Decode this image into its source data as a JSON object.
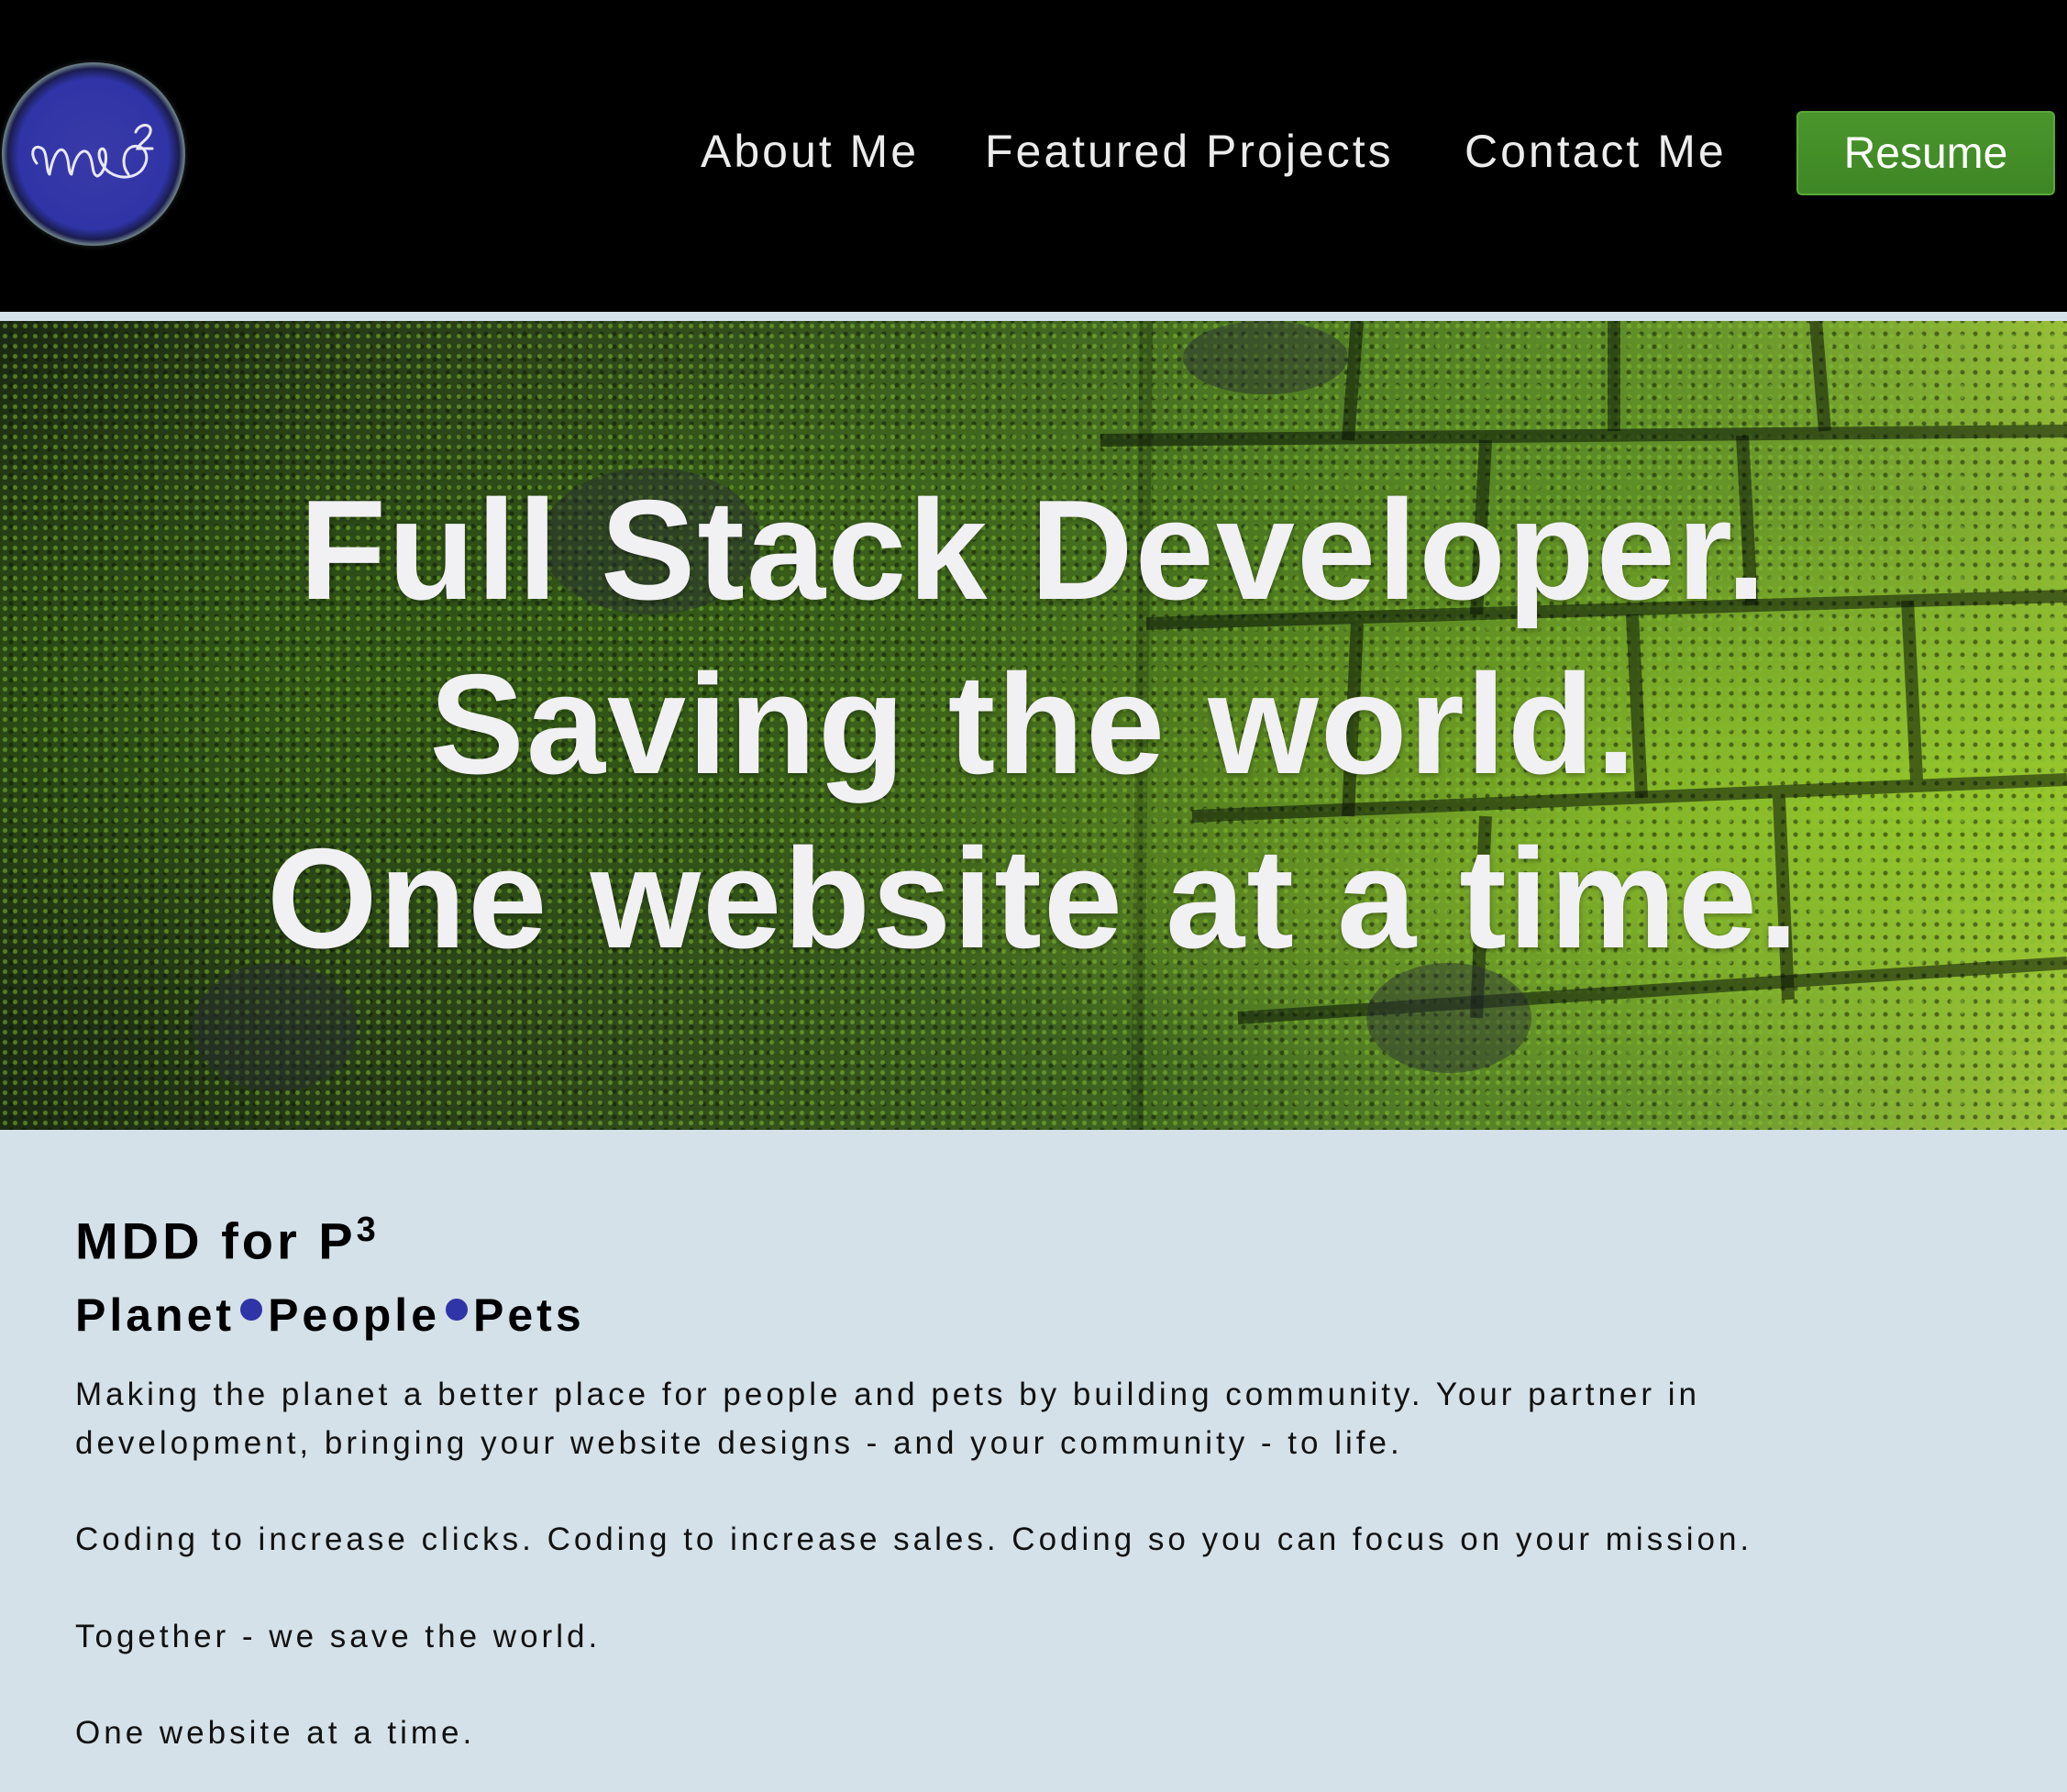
{
  "nav": {
    "logo_text": "MD³",
    "links": [
      {
        "label": "About Me"
      },
      {
        "label": "Featured Projects"
      },
      {
        "label": "Contact Me"
      }
    ],
    "resume_label": "Resume"
  },
  "hero": {
    "lines": [
      "Full Stack Developer.",
      "Saving the world.",
      "One website at a time."
    ]
  },
  "intro": {
    "title": "MDD for P",
    "title_superscript": "3",
    "tagline": [
      "Planet",
      "People",
      "Pets"
    ],
    "paragraph1_line1": "Making the planet a better place for people and pets by building community. Your partner in",
    "paragraph1_line2": "development, bringing your website designs - and your community - to life.",
    "paragraph2": "Coding to increase clicks. Coding to increase sales. Coding so you can focus on your mission.",
    "paragraph3": "Together - we save the world.",
    "paragraph4": "One website at a time."
  },
  "colors": {
    "navbar_bg": "#000000",
    "resume_button": "#418a27",
    "logo_circle": "#2f34a6",
    "page_bg": "#d4e1e8",
    "bullet_dot": "#2f34a6"
  }
}
